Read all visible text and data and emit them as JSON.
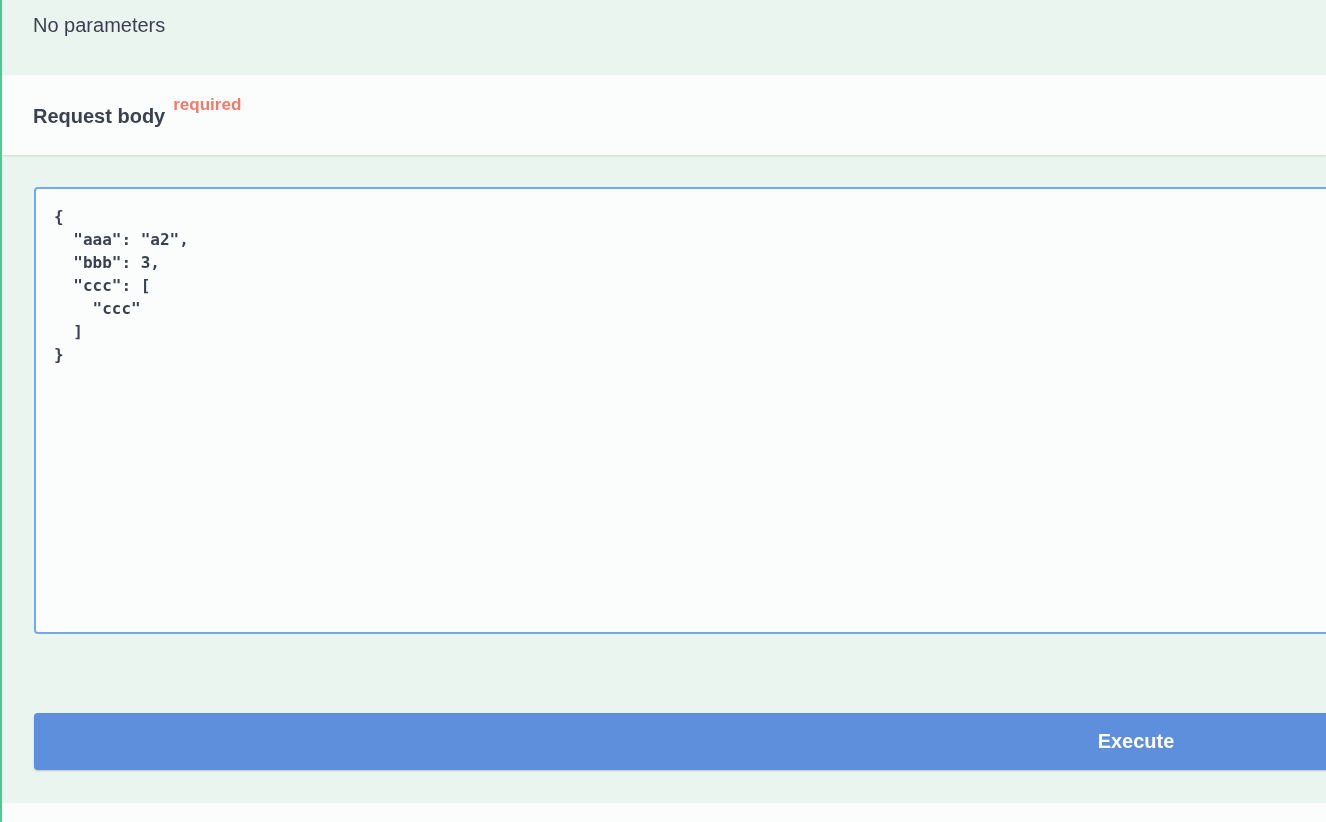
{
  "parameters": {
    "message": "No parameters"
  },
  "request_body": {
    "title": "Request body",
    "required_label": "required",
    "value": "{\n  \"aaa\": \"a2\",\n  \"bbb\": 3,\n  \"ccc\": [\n    \"ccc\"\n  ]\n}"
  },
  "execute_button": {
    "label": "Execute"
  }
}
